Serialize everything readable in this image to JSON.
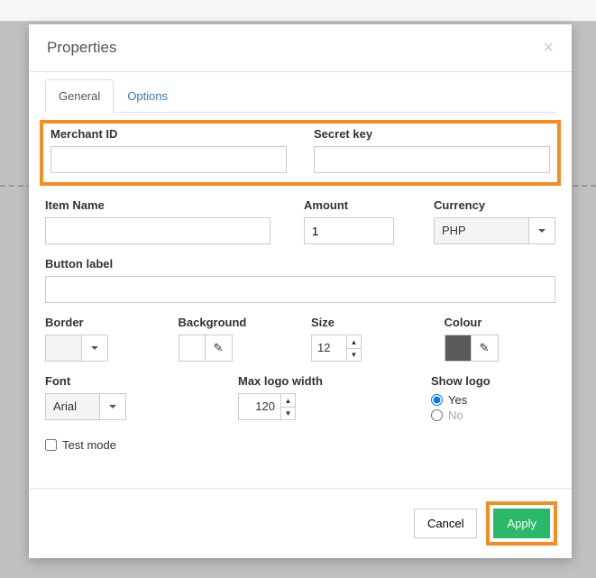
{
  "modal": {
    "title": "Properties",
    "tabs": {
      "general": "General",
      "options": "Options"
    }
  },
  "fields": {
    "merchant_id": {
      "label": "Merchant ID",
      "value": ""
    },
    "secret_key": {
      "label": "Secret key",
      "value": ""
    },
    "item_name": {
      "label": "Item Name",
      "value": ""
    },
    "amount": {
      "label": "Amount",
      "value": "1"
    },
    "currency": {
      "label": "Currency",
      "value": "PHP"
    },
    "button_label": {
      "label": "Button label",
      "value": ""
    },
    "border": {
      "label": "Border",
      "swatch": "#ffffff"
    },
    "background": {
      "label": "Background",
      "swatch": "#ffffff"
    },
    "size": {
      "label": "Size",
      "value": "12"
    },
    "colour": {
      "label": "Colour",
      "swatch": "#5a5a5a"
    },
    "font": {
      "label": "Font",
      "value": "Arial"
    },
    "max_logo_width": {
      "label": "Max logo width",
      "value": "120"
    },
    "show_logo": {
      "label": "Show logo",
      "yes": "Yes",
      "no": "No",
      "selected": "yes"
    },
    "test_mode": {
      "label": "Test mode",
      "checked": false
    }
  },
  "footer": {
    "cancel": "Cancel",
    "apply": "Apply"
  }
}
